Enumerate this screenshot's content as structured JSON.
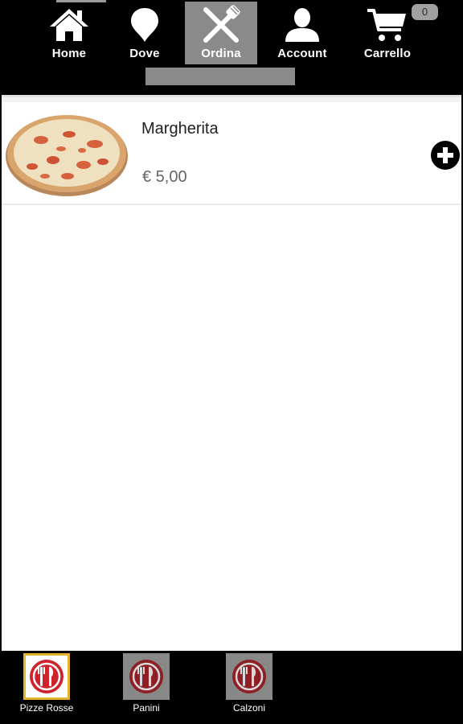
{
  "nav": {
    "items": [
      {
        "label": "Home",
        "icon": "home-icon"
      },
      {
        "label": "Dove",
        "icon": "map-pin-icon"
      },
      {
        "label": "Ordina",
        "icon": "fork-knife-icon",
        "active": true
      },
      {
        "label": "Account",
        "icon": "user-icon"
      },
      {
        "label": "Carrello",
        "icon": "cart-icon"
      }
    ],
    "cart_count": "0"
  },
  "products": [
    {
      "name": "Margherita",
      "price": "€ 5,00",
      "image": "pizza-image"
    }
  ],
  "categories": [
    {
      "label": "Pizze Rosse",
      "icon": "cutlery-plate-icon",
      "active": true
    },
    {
      "label": "Panini",
      "icon": "cutlery-plate-icon"
    },
    {
      "label": "Calzoni",
      "icon": "cutlery-plate-icon"
    }
  ],
  "colors": {
    "nav_active": "#8a8a8a",
    "category_icon_red": "#d0222a",
    "category_active_border": "#e5b32e"
  }
}
